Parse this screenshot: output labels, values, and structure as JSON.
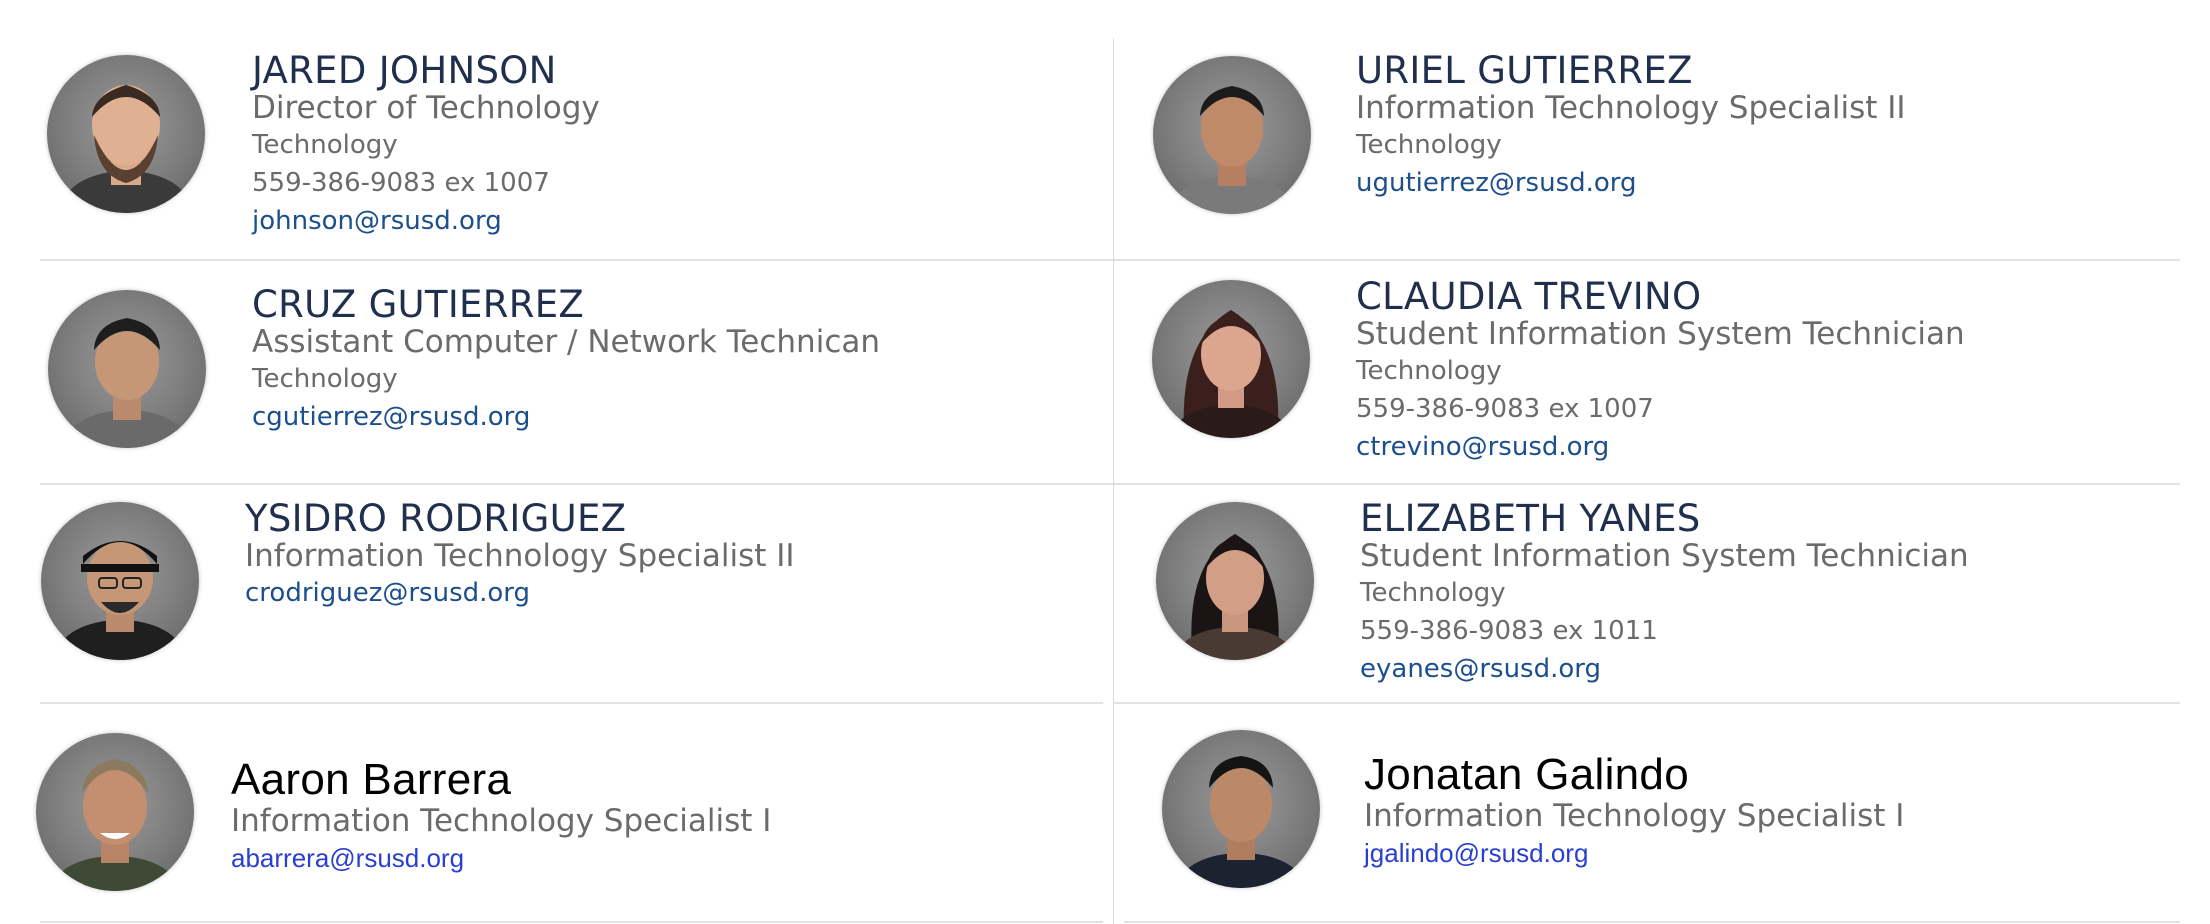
{
  "staff": [
    {
      "name": "JARED JOHNSON",
      "title": "Director of Technology",
      "department": "Technology",
      "phone": "559-386-9083 ex 1007",
      "email": "johnson@rsusd.org"
    },
    {
      "name": "URIEL GUTIERREZ",
      "title": "Information Technology Specialist II",
      "department": "Technology",
      "email": "ugutierrez@rsusd.org"
    },
    {
      "name": "CRUZ GUTIERREZ",
      "title": "Assistant Computer / Network Technican",
      "department": "Technology",
      "email": "cgutierrez@rsusd.org"
    },
    {
      "name": "CLAUDIA TREVINO",
      "title": "Student Information System Technician",
      "department": "Technology",
      "phone": "559-386-9083 ex 1007",
      "email": "ctrevino@rsusd.org"
    },
    {
      "name": "YSIDRO RODRIGUEZ",
      "title": "Information Technology Specialist II",
      "email": "crodriguez@rsusd.org"
    },
    {
      "name": "ELIZABETH YANES",
      "title": "Student Information System Technician",
      "department": "Technology",
      "phone": "559-386-9083 ex 1011",
      "email": "eyanes@rsusd.org"
    },
    {
      "name": "Aaron Barrera",
      "title": "Information Technology Specialist I",
      "email": "abarrera@rsusd.org"
    },
    {
      "name": "Jonatan Galindo",
      "title": "Information Technology Specialist I",
      "email": "jgalindo@rsusd.org"
    }
  ],
  "avatar_icon": "person-photo-icon",
  "colors": {
    "name": "#1f2f4d",
    "secondary_text": "#6b6b6b",
    "email_link": "#1d4f8c",
    "email_link_alt": "#2a3fd0",
    "divider": "#e2e2e2"
  }
}
